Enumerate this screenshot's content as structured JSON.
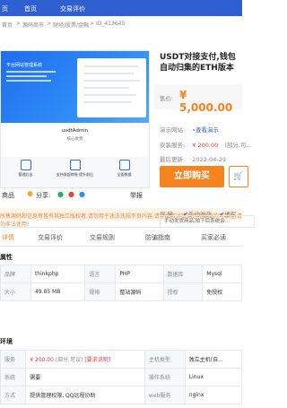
{
  "nav": {
    "items": [
      "页",
      "首页",
      "交易评价"
    ]
  },
  "breadcrumb": [
    "首页",
    ">",
    "源码商市",
    ">",
    "财经/股票/金融",
    ">",
    "ID_413645"
  ],
  "preview": {
    "banner_title": "平台网站管理系统",
    "logo_text": "usdtAdmin",
    "logo_sub": "核心优势",
    "features": [
      "管理后台",
      "支持发起转账 提升前后",
      "全面数据"
    ]
  },
  "share": {
    "favorite": "商品",
    "share": "分享:",
    "report": "举报"
  },
  "notice": "所售源码和信息等皆有其独立版权者,请勿用于违法违规不良内容,请仔细核对检测这件商品的可靠性,请勿非法使用!",
  "product": {
    "title": "USDT对接支付,钱包自动归集的ETH版本",
    "price_label": "售价:",
    "price": "¥ 5,000.00",
    "demo_label": "演示网站:",
    "demo_link": "查看演示",
    "install_label": "安装服务:",
    "install_value": "¥ 200.00",
    "install_note": "(部分,可...",
    "updated_label": "最后更新:",
    "updated_value": "2022-04-29",
    "buy_label": "立即购买",
    "cart_icon": "cart-icon",
    "guarantee_label": "保    障:",
    "guarantee_items": [
      "手动发货",
      "请保"
    ],
    "tags": [
      "手动发货商品,拍下后系统会..."
    ]
  },
  "tabs": [
    "详情",
    "交易评价",
    "交易规则",
    "防骗指南",
    "买家必读"
  ],
  "attrs": {
    "title": "属性",
    "rows": [
      [
        "品牌",
        "thinkphp",
        "语言",
        "PHP",
        "数据库",
        "Mysql"
      ],
      [
        "大小",
        "49.85 MB",
        "规格",
        "整站源码",
        "授权",
        "免授权"
      ]
    ]
  },
  "env": {
    "title": "环境",
    "rows": [
      [
        "服务",
        "¥ 200.00",
        "(部分,可议)",
        "[要求说明]",
        "主机类型",
        "独立主机(自..."
      ],
      [
        "系统",
        "需要",
        "",
        "",
        "操作系统",
        "Linux"
      ],
      [
        "方式",
        "提供管理权限, QQ远程协助",
        "",
        "",
        "web服务",
        "nginx"
      ]
    ]
  },
  "colors": {
    "nav": "#2f5fd0",
    "accent": "#f5841f",
    "price": "#f5841f",
    "warn": "#e23b3b"
  }
}
